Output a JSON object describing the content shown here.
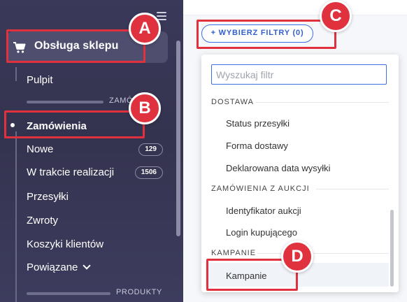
{
  "sidebar": {
    "title": "Obsługa sklepu",
    "items": [
      {
        "label": "Pulpit"
      },
      {
        "label": "Zamówienia"
      },
      {
        "label": "Nowe",
        "count": "129"
      },
      {
        "label": "W trakcie realizacji",
        "count": "1506"
      },
      {
        "label": "Przesyłki"
      },
      {
        "label": "Zwroty"
      },
      {
        "label": "Koszyki klientów"
      },
      {
        "label": "Powiązane"
      }
    ],
    "section_orders": "ZAMÓ",
    "section_products": "PRODUKTY"
  },
  "filters": {
    "button_label": "+ WYBIERZ FILTRY (0)",
    "search_placeholder": "Wyszukaj filtr",
    "groups": [
      {
        "label": "DOSTAWA",
        "options": [
          "Status przesyłki",
          "Forma dostawy",
          "Deklarowana data wysyłki"
        ]
      },
      {
        "label": "ZAMÓWIENIA Z AUKCJI",
        "options": [
          "Identyfikator aukcji",
          "Login kupującego"
        ]
      },
      {
        "label": "KAMPANIE",
        "options": [
          "Kampanie"
        ]
      }
    ]
  },
  "annotations": [
    "A",
    "B",
    "C",
    "D"
  ],
  "colors": {
    "sidebar": "#3a3959",
    "accent": "#3c6fe0",
    "highlight": "#e0323e"
  }
}
